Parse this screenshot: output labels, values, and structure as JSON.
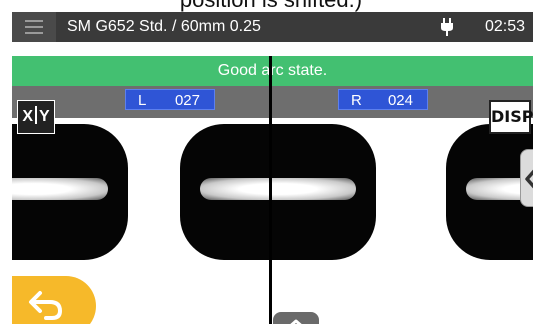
{
  "page": {
    "caption": "position is shifted.)"
  },
  "topbar": {
    "title": "SM G652 Std. / 60mm 0.25",
    "time": "02:53",
    "menu_icon": "hamburger-menu-icon",
    "power_icon": "power-plug-icon"
  },
  "status": {
    "message": "Good arc state.",
    "color": "#43c071"
  },
  "view": {
    "left_side": "L",
    "left_value": "027",
    "right_side": "R",
    "right_value": "024",
    "xy_label_x": "X",
    "xy_label_y": "Y",
    "disp_label": "DISP"
  },
  "controls": {
    "back_icon": "back-arrow-icon",
    "side_icon": "chevron-left-icon",
    "up_icon": "chevron-up-icon",
    "back_color": "#f6b92a"
  }
}
